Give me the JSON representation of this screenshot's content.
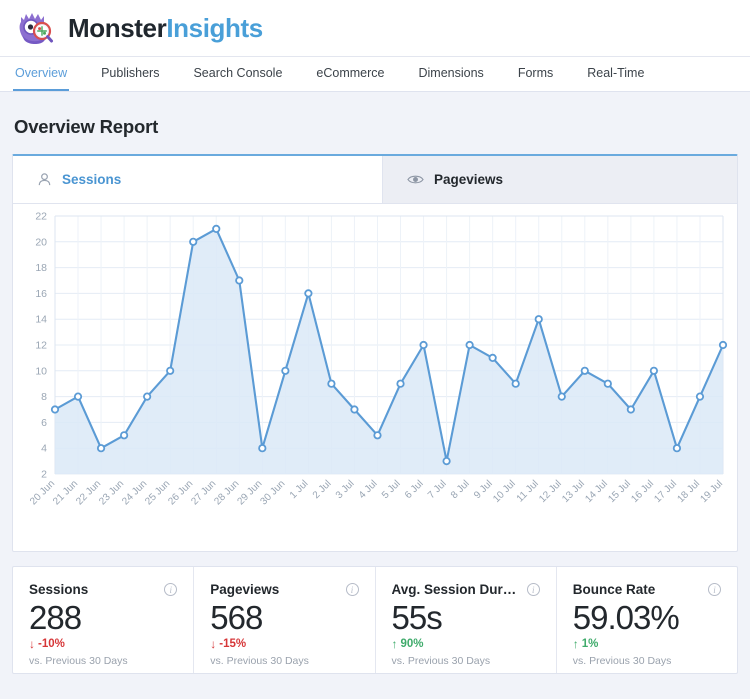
{
  "brand": {
    "name_part1": "Monster",
    "name_part2": "Insights",
    "logo_icon": "monster-magnifier-icon",
    "color_primary": "#499fd8",
    "color_dark": "#20272e"
  },
  "nav": {
    "items": [
      {
        "label": "Overview",
        "active": true
      },
      {
        "label": "Publishers",
        "active": false
      },
      {
        "label": "Search Console",
        "active": false
      },
      {
        "label": "eCommerce",
        "active": false
      },
      {
        "label": "Dimensions",
        "active": false
      },
      {
        "label": "Forms",
        "active": false
      },
      {
        "label": "Real-Time",
        "active": false
      }
    ]
  },
  "page": {
    "title": "Overview Report"
  },
  "chart_tabs": [
    {
      "label": "Sessions",
      "icon": "user-icon",
      "active": true
    },
    {
      "label": "Pageviews",
      "icon": "eye-icon",
      "active": false
    }
  ],
  "stats": [
    {
      "title": "Sessions",
      "value": "288",
      "delta": "-10%",
      "direction": "down",
      "arrow": "↓",
      "note": "vs. Previous 30 Days",
      "info_icon": "info-icon"
    },
    {
      "title": "Pageviews",
      "value": "568",
      "delta": "-15%",
      "direction": "down",
      "arrow": "↓",
      "note": "vs. Previous 30 Days",
      "info_icon": "info-icon"
    },
    {
      "title": "Avg. Session Dur…",
      "value": "55s",
      "delta": "90%",
      "direction": "up",
      "arrow": "↑",
      "note": "vs. Previous 30 Days",
      "info_icon": "info-icon"
    },
    {
      "title": "Bounce Rate",
      "value": "59.03%",
      "delta": "1%",
      "direction": "up",
      "arrow": "↑",
      "note": "vs. Previous 30 Days",
      "info_icon": "info-icon"
    }
  ],
  "chart_data": {
    "type": "area",
    "title": "",
    "xlabel": "",
    "ylabel": "",
    "series_name": "Sessions",
    "line_color": "#5b9bd5",
    "fill_color": "#dbe9f7",
    "grid": true,
    "legend": "none",
    "ylim": [
      2,
      22
    ],
    "yticks": [
      2,
      4,
      6,
      8,
      10,
      12,
      14,
      16,
      18,
      20,
      22
    ],
    "categories": [
      "20 Jun",
      "21 Jun",
      "22 Jun",
      "23 Jun",
      "24 Jun",
      "25 Jun",
      "26 Jun",
      "27 Jun",
      "28 Jun",
      "29 Jun",
      "30 Jun",
      "1 Jul",
      "2 Jul",
      "3 Jul",
      "4 Jul",
      "5 Jul",
      "6 Jul",
      "7 Jul",
      "8 Jul",
      "9 Jul",
      "10 Jul",
      "11 Jul",
      "12 Jul",
      "13 Jul",
      "14 Jul",
      "15 Jul",
      "16 Jul",
      "17 Jul",
      "18 Jul",
      "19 Jul"
    ],
    "values": [
      7,
      8,
      4,
      5,
      8,
      10,
      20,
      21,
      17,
      4,
      10,
      16,
      9,
      7,
      5,
      9,
      12,
      3,
      12,
      11,
      9,
      14,
      8,
      10,
      9,
      7,
      10,
      4,
      8,
      12
    ]
  }
}
